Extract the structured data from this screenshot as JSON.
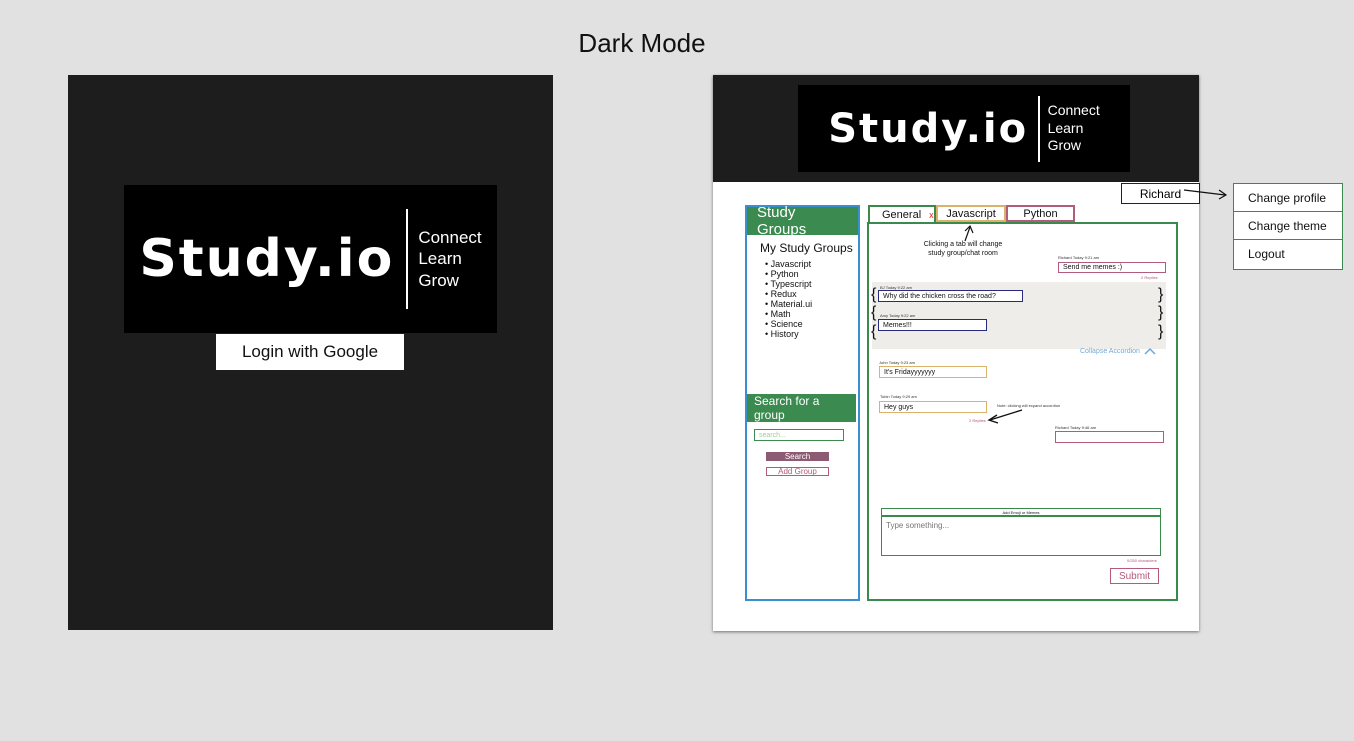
{
  "page": {
    "title": "Dark Mode"
  },
  "brand": {
    "name": "Study.io",
    "taglines": [
      "Connect",
      "Learn",
      "Grow"
    ]
  },
  "login": {
    "button_label": "Login with Google"
  },
  "user_menu": {
    "user_name": "Richard",
    "items": [
      "Change profile",
      "Change theme",
      "Logout"
    ]
  },
  "sidebar": {
    "title": "Study Groups",
    "my_groups_heading": "My Study Groups",
    "groups": [
      "Javascript",
      "Python",
      "Typescript",
      "Redux",
      "Material.ui",
      "Math",
      "Science",
      "History"
    ],
    "search_heading": "Search for a group",
    "search_placeholder": "search...",
    "search_button": "Search",
    "add_group_button": "Add Group"
  },
  "tabs": {
    "items": [
      "General",
      "Javascript",
      "Python"
    ],
    "close_glyph": "x"
  },
  "notes": {
    "tab_note": "Clicking a tab will change study group/chat room",
    "reply_note": "Note: clicking will expand accordion",
    "collapse_label": "Collapse Accordion"
  },
  "messages": [
    {
      "meta": "Richard Today 9:21 am",
      "text": "Send me memes :)",
      "replies": "2 Replies"
    },
    {
      "meta": "BJ Today 9:22 am",
      "text": "Why did the chicken cross the road?"
    },
    {
      "meta": "Amy Today 9:22 am",
      "text": "Memes!!!"
    },
    {
      "meta": "John Today 9:23 am",
      "text": "It's Fridayyyyyyy"
    },
    {
      "meta": "Tobin Today 9:29 am",
      "text": "Hey guys",
      "replies": "2 Replies"
    },
    {
      "meta": "Richard Today 9:46 am",
      "text": ""
    }
  ],
  "composer": {
    "emoji_bar": "Add Emoji or Memes",
    "placeholder": "Type something...",
    "char_count": "0/250 characters",
    "submit": "Submit"
  },
  "colors": {
    "background": "#e1e1e1",
    "dark_panel": "#1d1d1d",
    "green": "#3b8a4f",
    "blue": "#3a8fd0",
    "mauve": "#b35a7d",
    "tan": "#d9b36a",
    "navy": "#2a2a7a"
  }
}
